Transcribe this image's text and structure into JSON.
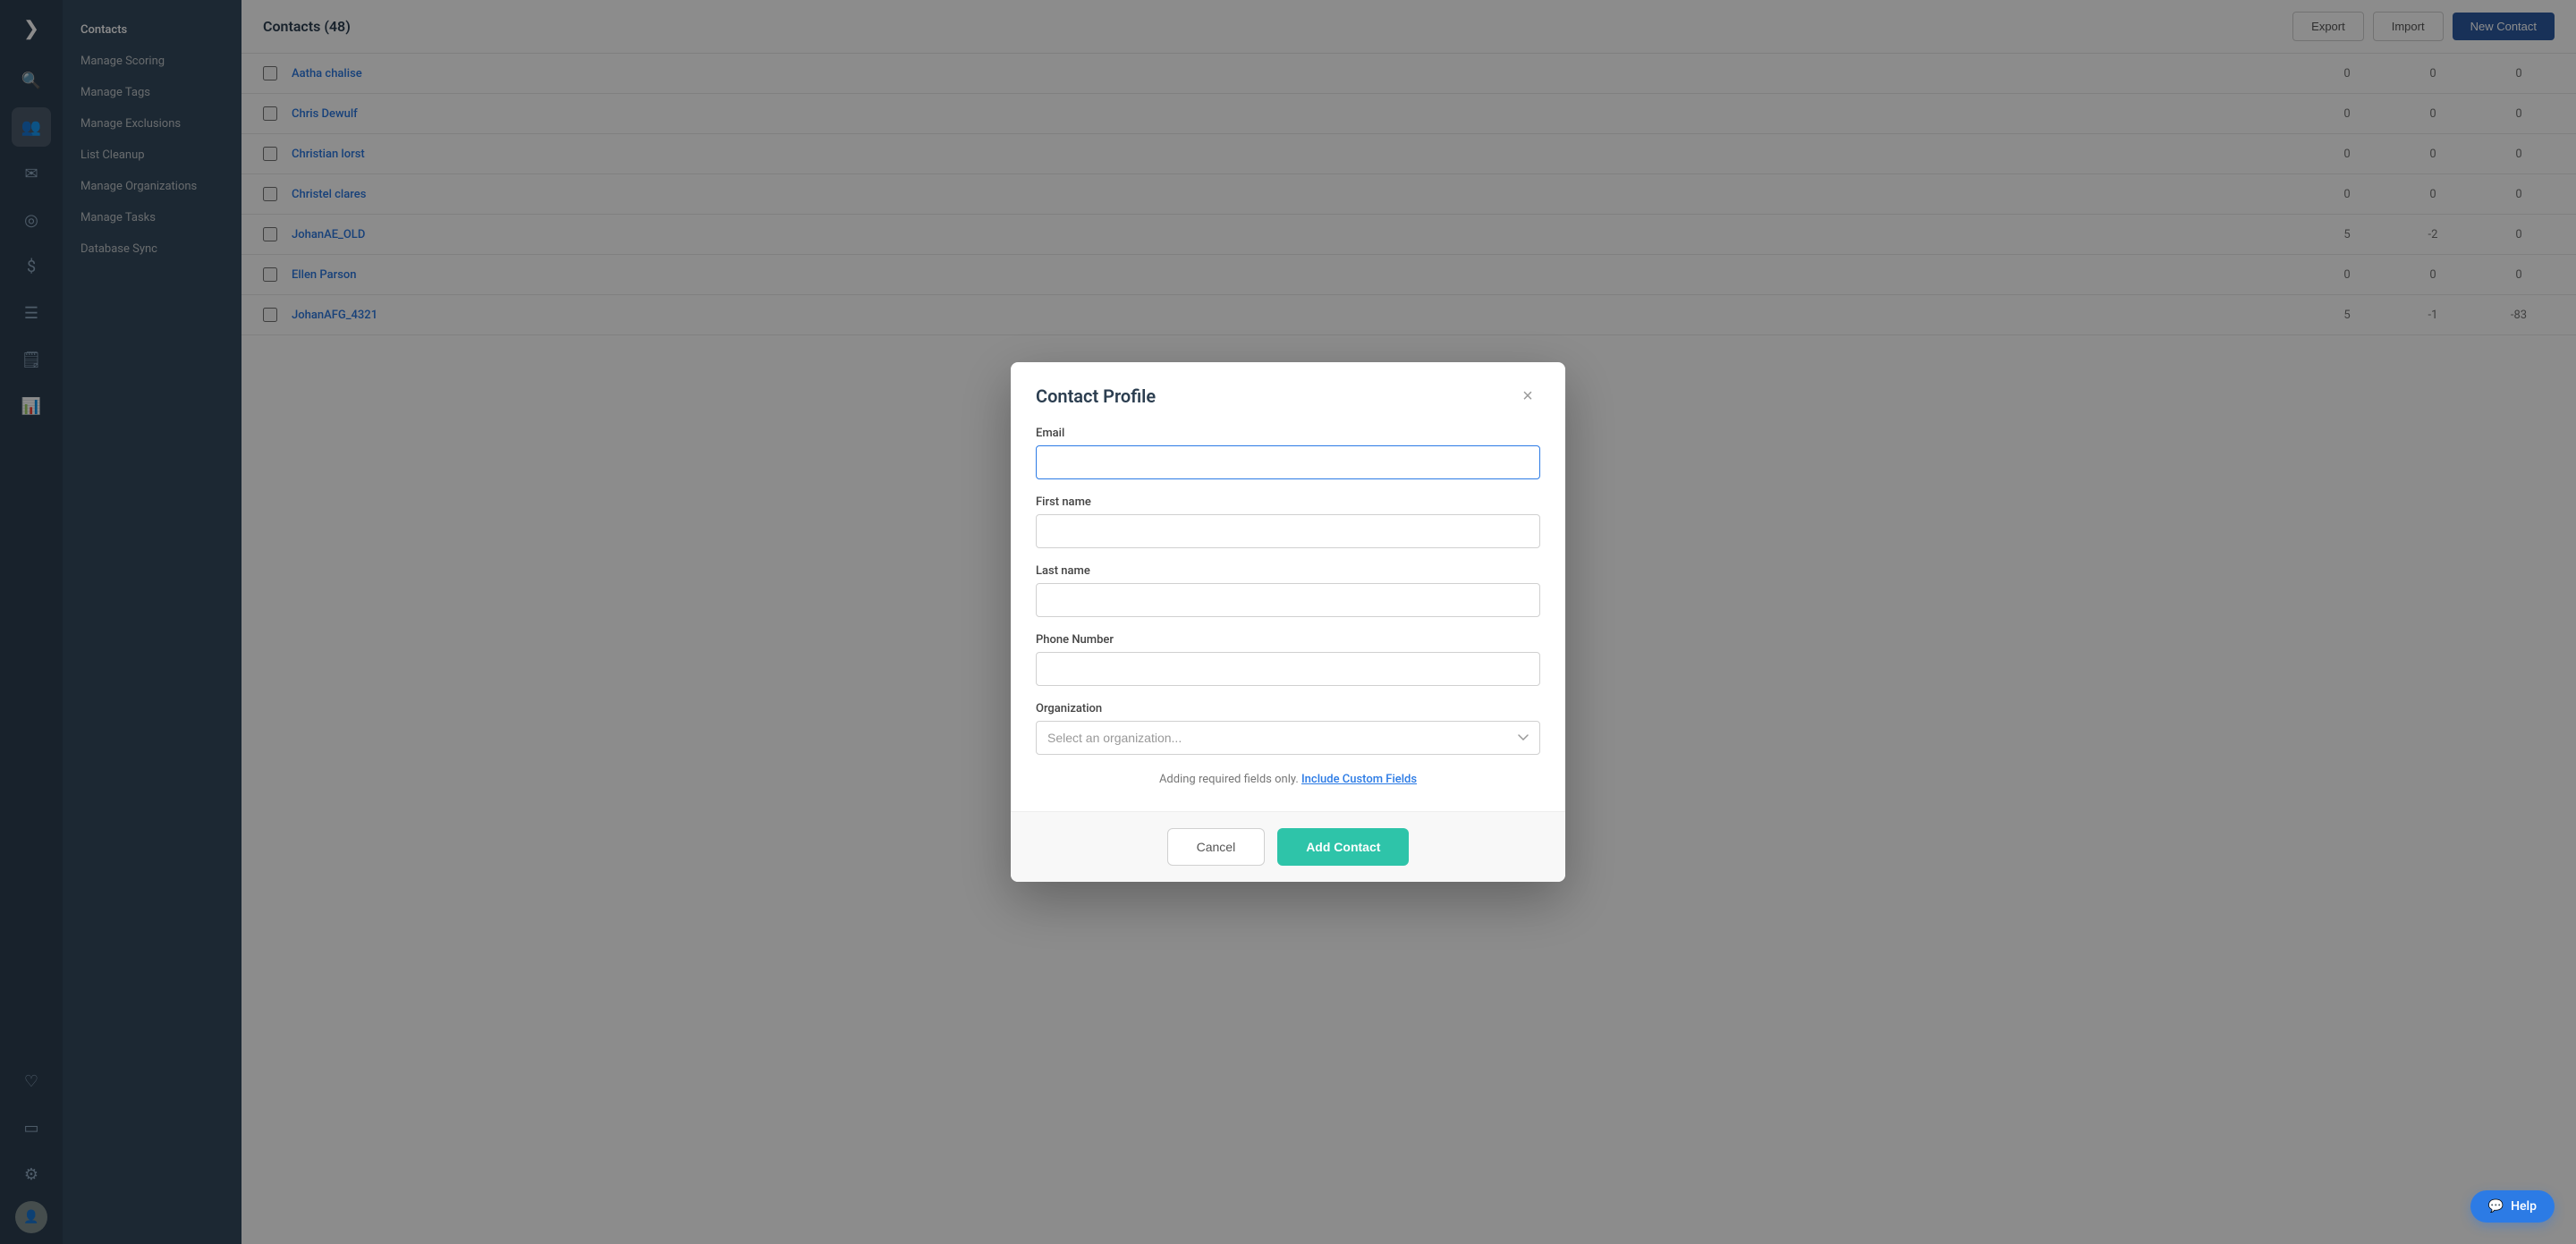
{
  "app": {
    "logo": "❯"
  },
  "iconbar": {
    "icons": [
      {
        "name": "search-icon",
        "symbol": "🔍"
      },
      {
        "name": "contacts-icon",
        "symbol": "👥"
      },
      {
        "name": "mail-icon",
        "symbol": "✉"
      },
      {
        "name": "target-icon",
        "symbol": "◎"
      },
      {
        "name": "dollar-icon",
        "symbol": "$"
      },
      {
        "name": "list-icon",
        "symbol": "☰"
      },
      {
        "name": "document-icon",
        "symbol": "🗒"
      },
      {
        "name": "chart-icon",
        "symbol": "📊"
      },
      {
        "name": "heart-icon",
        "symbol": "♡"
      },
      {
        "name": "panel-icon",
        "symbol": "▭"
      },
      {
        "name": "settings-icon",
        "symbol": "⚙"
      }
    ]
  },
  "sidebar": {
    "items": [
      {
        "label": "Contacts",
        "active": true
      },
      {
        "label": "Manage Scoring",
        "active": false
      },
      {
        "label": "Manage Tags",
        "active": false
      },
      {
        "label": "Manage Exclusions",
        "active": false
      },
      {
        "label": "List Cleanup",
        "active": false
      },
      {
        "label": "Manage Organizations",
        "active": false
      },
      {
        "label": "Manage Tasks",
        "active": false
      },
      {
        "label": "Database Sync",
        "active": false
      }
    ]
  },
  "header": {
    "title": "Contacts (48)",
    "export_label": "Export",
    "import_label": "Import",
    "new_contact_label": "New Contact"
  },
  "contacts": [
    {
      "name": "Aatha chalise",
      "col1": "0",
      "col2": "0",
      "col3": "0"
    },
    {
      "name": "Chris Dewulf",
      "col1": "0",
      "col2": "0",
      "col3": "0"
    },
    {
      "name": "Christian lorst",
      "col1": "0",
      "col2": "0",
      "col3": "0"
    },
    {
      "name": "Christel clares",
      "col1": "0",
      "col2": "0",
      "col3": "0"
    },
    {
      "name": "JohanAE_OLD",
      "col1": "5",
      "col2": "-2",
      "col3": "0"
    },
    {
      "name": "Ellen Parson",
      "col1": "0",
      "col2": "0",
      "col3": "0"
    },
    {
      "name": "JohanAFG_4321",
      "col1": "5",
      "col2": "-1",
      "col3": "-83"
    }
  ],
  "modal": {
    "title": "Contact Profile",
    "close_label": "×",
    "email_label": "Email",
    "email_placeholder": "",
    "firstname_label": "First name",
    "firstname_placeholder": "",
    "lastname_label": "Last name",
    "lastname_placeholder": "",
    "phone_label": "Phone Number",
    "phone_placeholder": "",
    "org_label": "Organization",
    "org_placeholder": "Select an organization...",
    "note_text": "Adding required fields only.",
    "custom_fields_link": "Include Custom Fields",
    "cancel_label": "Cancel",
    "add_contact_label": "Add Contact"
  },
  "help": {
    "label": "Help"
  }
}
